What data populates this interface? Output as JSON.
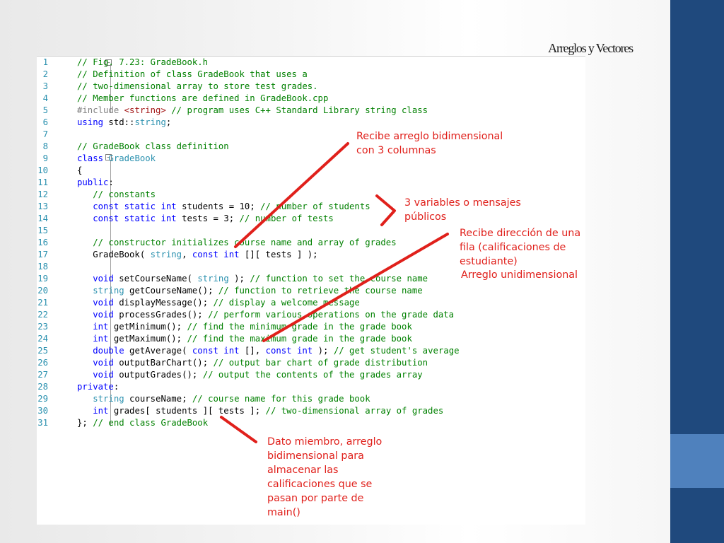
{
  "slide": {
    "title": "Arreglos y Vectores"
  },
  "code": {
    "lines": [
      {
        "n": "1",
        "html": "<span style=\"color:#008000\">// Fig. 7.23: GradeBook.h</span>"
      },
      {
        "n": "2",
        "html": "<span style=\"color:#008000\">// Definition of class GradeBook that uses a</span>"
      },
      {
        "n": "3",
        "html": "<span style=\"color:#008000\">// two-dimensional array to store test grades.</span>"
      },
      {
        "n": "4",
        "html": "<span style=\"color:#008000\">// Member functions are defined in GradeBook.cpp</span>"
      },
      {
        "n": "5",
        "html": "<span style=\"color:#808080\">#include</span> <span style=\"color:#a31515\">&lt;string&gt;</span> <span style=\"color:#008000\">// program uses C++ Standard Library string class</span>"
      },
      {
        "n": "6",
        "html": "<span style=\"color:#0000ff\">using</span> std::<span style=\"color:#2b91af\">string</span>;"
      },
      {
        "n": "7",
        "html": ""
      },
      {
        "n": "8",
        "html": "<span style=\"color:#008000\">// GradeBook class definition</span>"
      },
      {
        "n": "9",
        "html": "<span style=\"color:#0000ff\">class</span> <span style=\"color:#2b91af\">GradeBook</span>"
      },
      {
        "n": "10",
        "html": "{"
      },
      {
        "n": "11",
        "html": "<span style=\"color:#0000ff\">public</span>:"
      },
      {
        "n": "12",
        "html": "   <span style=\"color:#008000\">// constants</span>"
      },
      {
        "n": "13",
        "html": "   <span style=\"color:#0000ff\">const static int</span> students = 10; <span style=\"color:#008000\">// number of students</span>"
      },
      {
        "n": "14",
        "html": "   <span style=\"color:#0000ff\">const static int</span> tests = 3; <span style=\"color:#008000\">// number of tests</span>"
      },
      {
        "n": "15",
        "html": ""
      },
      {
        "n": "16",
        "html": "   <span style=\"color:#008000\">// constructor initializes course name and array of grades</span>"
      },
      {
        "n": "17",
        "html": "   GradeBook( <span style=\"color:#2b91af\">string</span>, <span style=\"color:#0000ff\">const int</span> [][ tests ] );"
      },
      {
        "n": "18",
        "html": ""
      },
      {
        "n": "19",
        "html": "   <span style=\"color:#0000ff\">void</span> setCourseName( <span style=\"color:#2b91af\">string</span> ); <span style=\"color:#008000\">// function to set the course name</span>"
      },
      {
        "n": "20",
        "html": "   <span style=\"color:#2b91af\">string</span> getCourseName(); <span style=\"color:#008000\">// function to retrieve the course name</span>"
      },
      {
        "n": "21",
        "html": "   <span style=\"color:#0000ff\">void</span> displayMessage(); <span style=\"color:#008000\">// display a welcome message</span>"
      },
      {
        "n": "22",
        "html": "   <span style=\"color:#0000ff\">void</span> processGrades(); <span style=\"color:#008000\">// perform various operations on the grade data</span>"
      },
      {
        "n": "23",
        "html": "   <span style=\"color:#0000ff\">int</span> getMinimum(); <span style=\"color:#008000\">// find the minimum grade in the grade book</span>"
      },
      {
        "n": "24",
        "html": "   <span style=\"color:#0000ff\">int</span> getMaximum(); <span style=\"color:#008000\">// find the maximum grade in the grade book</span>"
      },
      {
        "n": "25",
        "html": "   <span style=\"color:#0000ff\">double</span> getAverage( <span style=\"color:#0000ff\">const int</span> [], <span style=\"color:#0000ff\">const int</span> ); <span style=\"color:#008000\">// get student's average</span>"
      },
      {
        "n": "26",
        "html": "   <span style=\"color:#0000ff\">void</span> outputBarChart(); <span style=\"color:#008000\">// output bar chart of grade distribution</span>"
      },
      {
        "n": "27",
        "html": "   <span style=\"color:#0000ff\">void</span> outputGrades(); <span style=\"color:#008000\">// output the contents of the grades array</span>"
      },
      {
        "n": "28",
        "html": "<span style=\"color:#0000ff\">private</span>:"
      },
      {
        "n": "29",
        "html": "   <span style=\"color:#2b91af\">string</span> courseName; <span style=\"color:#008000\">// course name for this grade book</span>"
      },
      {
        "n": "30",
        "html": "   <span style=\"color:#0000ff\">int</span> grades[ students ][ tests ]; <span style=\"color:#008000\">// two-dimensional array of grades</span>"
      },
      {
        "n": "31",
        "html": "}; <span style=\"color:#008000\">// end class GradeBook</span>"
      }
    ]
  },
  "annotations": {
    "a1": "Recibe arreglo bidimensional\ncon 3 columnas",
    "a2": "3 variables o mensajes\npúblicos",
    "a3": "Recibe dirección de una\nfila (calificaciones de\nestudiante)",
    "a4": "Arreglo unidimensional",
    "a5": "Dato miembro, arreglo\nbidimensional para\nalmacenar las\ncalificaciones que se\npasan por parte de\nmain()"
  },
  "colors": {
    "annotation": "#e0201b",
    "sidebar_dark": "#1f497d",
    "sidebar_light": "#4f81bd"
  }
}
